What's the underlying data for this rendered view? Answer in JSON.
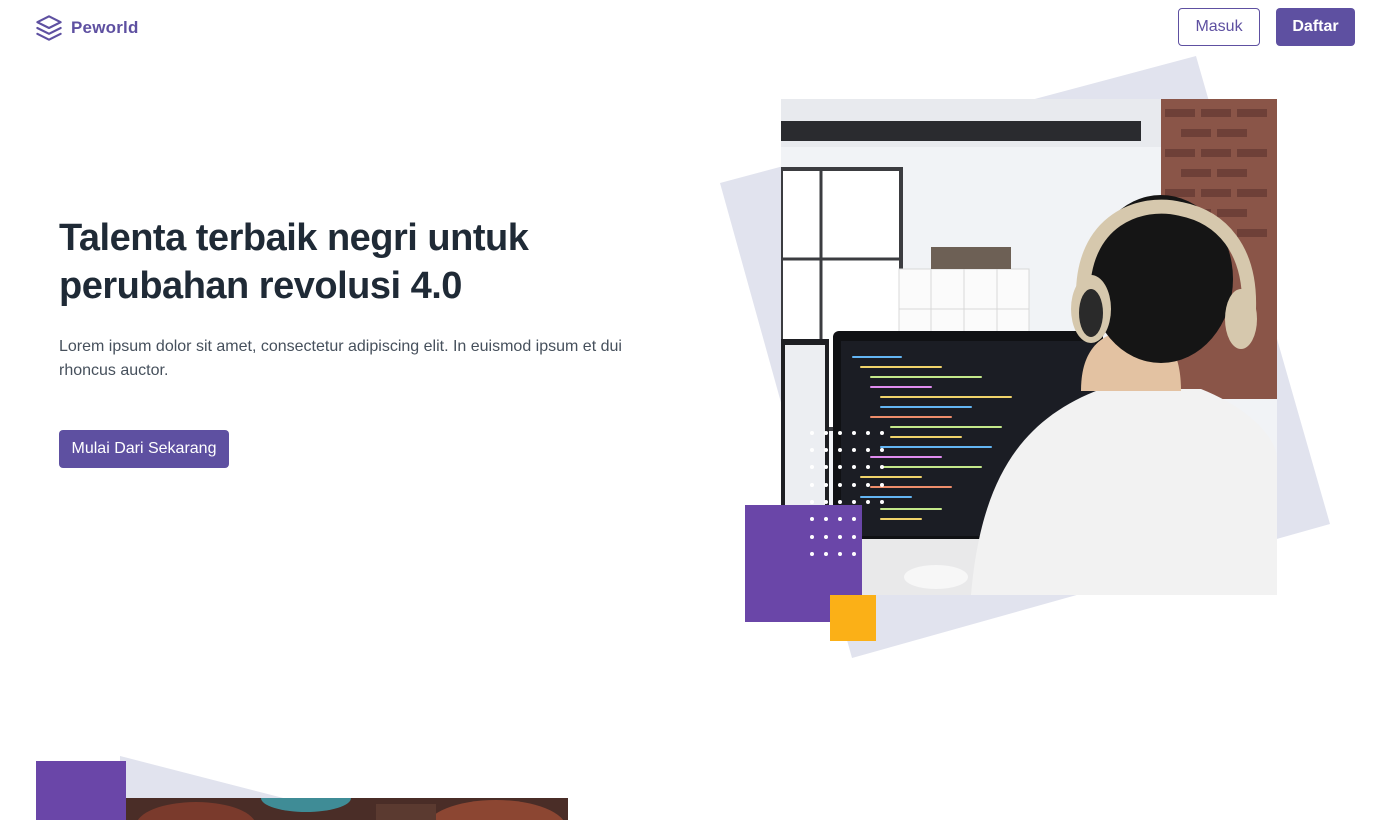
{
  "header": {
    "brand_name": "Peworld",
    "logo_icon": "layers-icon",
    "login_label": "Masuk",
    "register_label": "Daftar"
  },
  "hero": {
    "title": "Talenta terbaik negri untuk perubahan revolusi 4.0",
    "description": "Lorem ipsum dolor sit amet, consectetur adipiscing elit. In euismod ipsum et dui rhoncus auctor.",
    "cta_label": "Mulai Dari Sekarang"
  },
  "colors": {
    "brand": "#5e50a1",
    "accent_purple": "#6a46a8",
    "accent_yellow": "#fbb017",
    "backdrop": "#e1e3ee"
  }
}
